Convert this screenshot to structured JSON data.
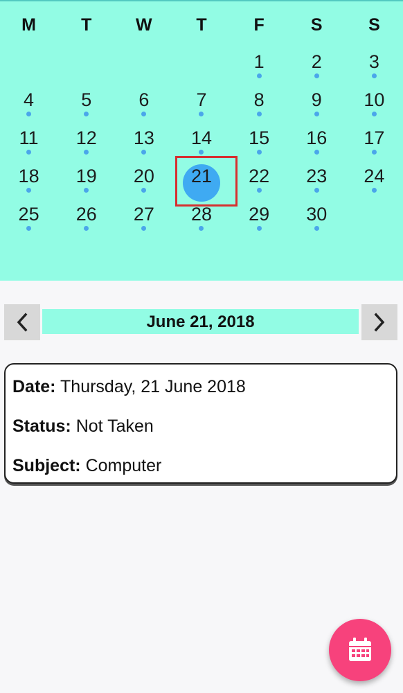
{
  "calendar": {
    "weekdays": [
      "M",
      "T",
      "W",
      "T",
      "F",
      "S",
      "S"
    ],
    "leading_blanks": 4,
    "days": [
      "1",
      "2",
      "3",
      "4",
      "5",
      "6",
      "7",
      "8",
      "9",
      "10",
      "11",
      "12",
      "13",
      "14",
      "15",
      "16",
      "17",
      "18",
      "19",
      "20",
      "21",
      "22",
      "23",
      "24",
      "25",
      "26",
      "27",
      "28",
      "29",
      "30"
    ],
    "selected_day": "21",
    "colors": {
      "background": "#92fce4",
      "selected": "#3faaf2",
      "selection_box": "#d62f2f",
      "dot": "#4aa6ea"
    }
  },
  "date_nav": {
    "prev_icon": "chevron-left-icon",
    "next_icon": "chevron-right-icon",
    "current_date": "June 21, 2018"
  },
  "details": {
    "date_label": "Date:",
    "date_value": "Thursday, 21 June 2018",
    "status_label": "Status:",
    "status_value": "Not Taken",
    "subject_label": "Subject:",
    "subject_value": "Computer"
  },
  "fab": {
    "icon": "calendar-icon",
    "color": "#f7427c"
  }
}
